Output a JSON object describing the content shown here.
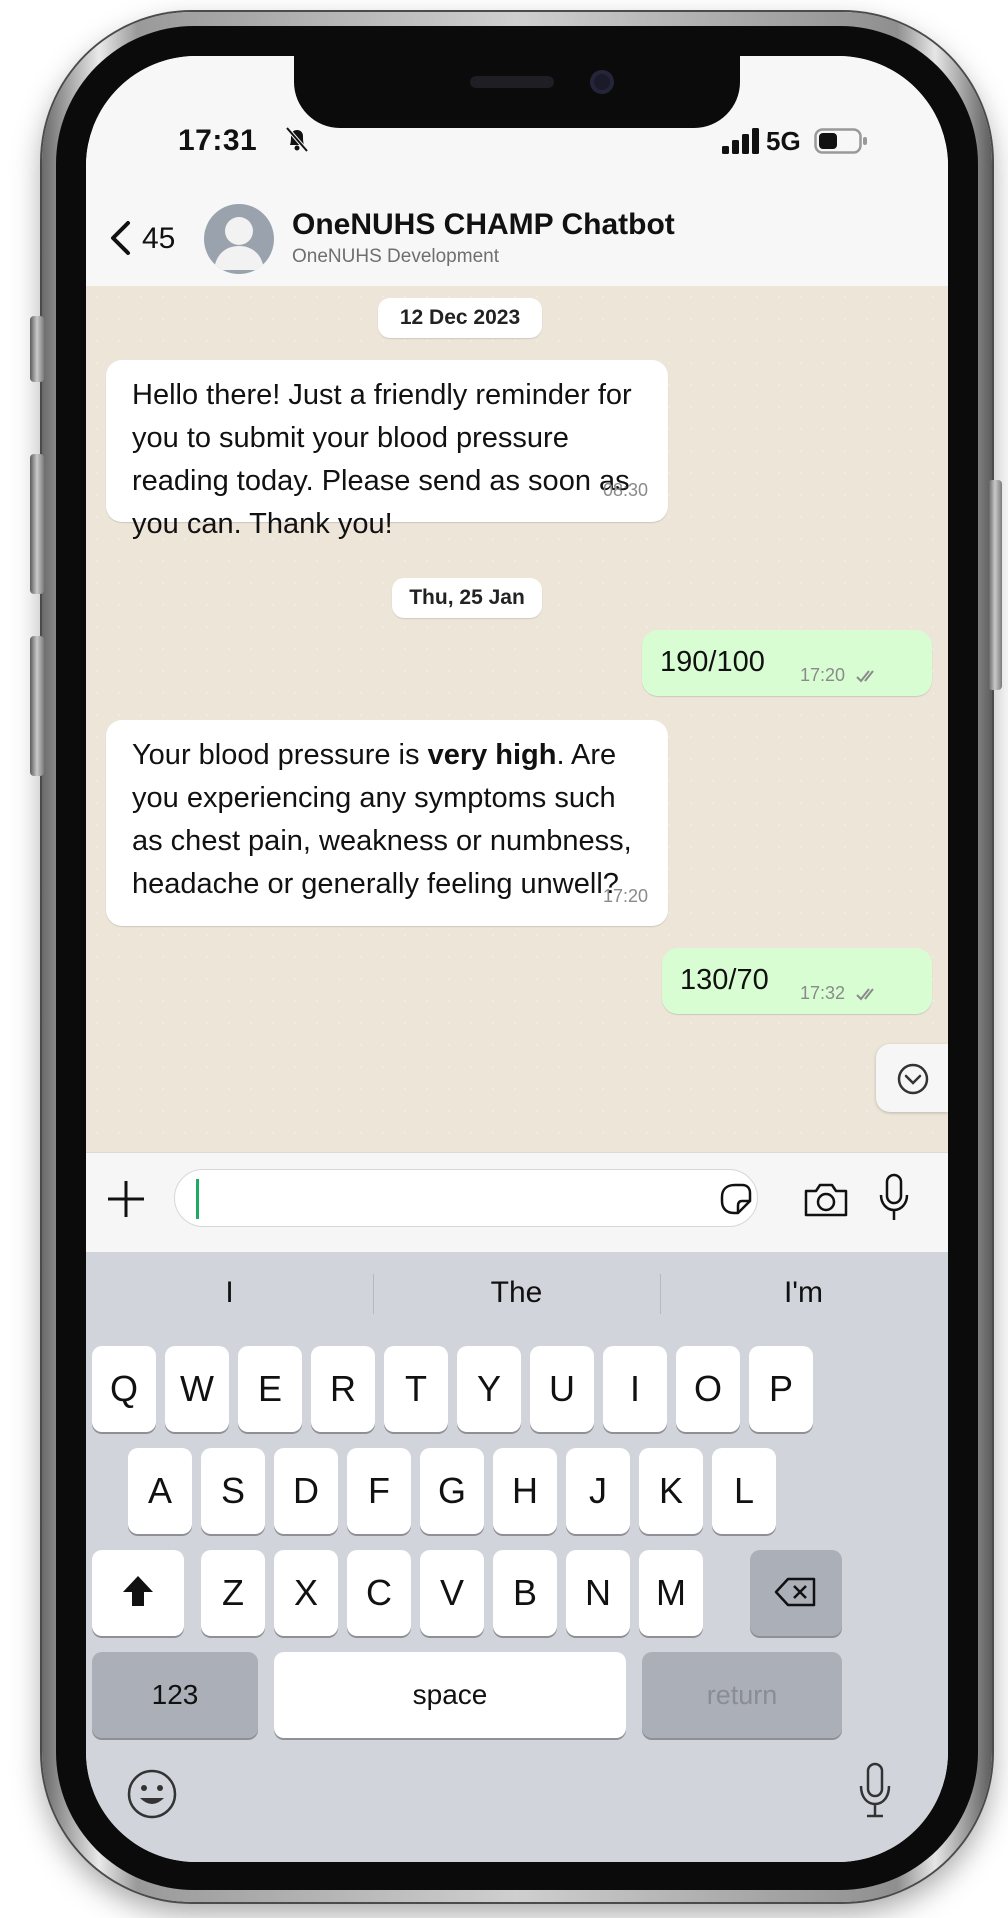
{
  "status_bar": {
    "time": "17:31",
    "network": "5G"
  },
  "header": {
    "back_count": "45",
    "contact_name": "OneNUHS CHAMP Chatbot",
    "contact_subtitle": "OneNUHS Development"
  },
  "chat": {
    "date_1": "12 Dec 2023",
    "message_1": {
      "text": "Hello there! Just a friendly reminder for you to submit your blood pressure reading today. Please send as soon as you can. Thank you!",
      "time": "08:30"
    },
    "date_2": "Thu, 25 Jan",
    "message_2": {
      "text": "190/100",
      "time": "17:20"
    },
    "message_3": {
      "text_before": "Your blood pressure is ",
      "text_bold": "very high",
      "text_after": ". Are you experiencing any symptoms such as chest pain, weakness or numbness, headache or generally feeling unwell?",
      "time": "17:20"
    },
    "message_4": {
      "text": "130/70",
      "time": "17:32"
    }
  },
  "input": {
    "value": "",
    "placeholder": ""
  },
  "keyboard": {
    "suggestions": [
      "I",
      "The",
      "I'm"
    ],
    "row1": [
      "Q",
      "W",
      "E",
      "R",
      "T",
      "Y",
      "U",
      "I",
      "O",
      "P"
    ],
    "row2": [
      "A",
      "S",
      "D",
      "F",
      "G",
      "H",
      "J",
      "K",
      "L"
    ],
    "row3": [
      "Z",
      "X",
      "C",
      "V",
      "B",
      "N",
      "M"
    ],
    "numbers_key": "123",
    "space_key": "space",
    "return_key": "return"
  },
  "colors": {
    "outgoing_bubble": "#d9fdd3",
    "incoming_bubble": "#ffffff",
    "chat_background": "#ece5d8",
    "cursor": "#1daa61"
  }
}
